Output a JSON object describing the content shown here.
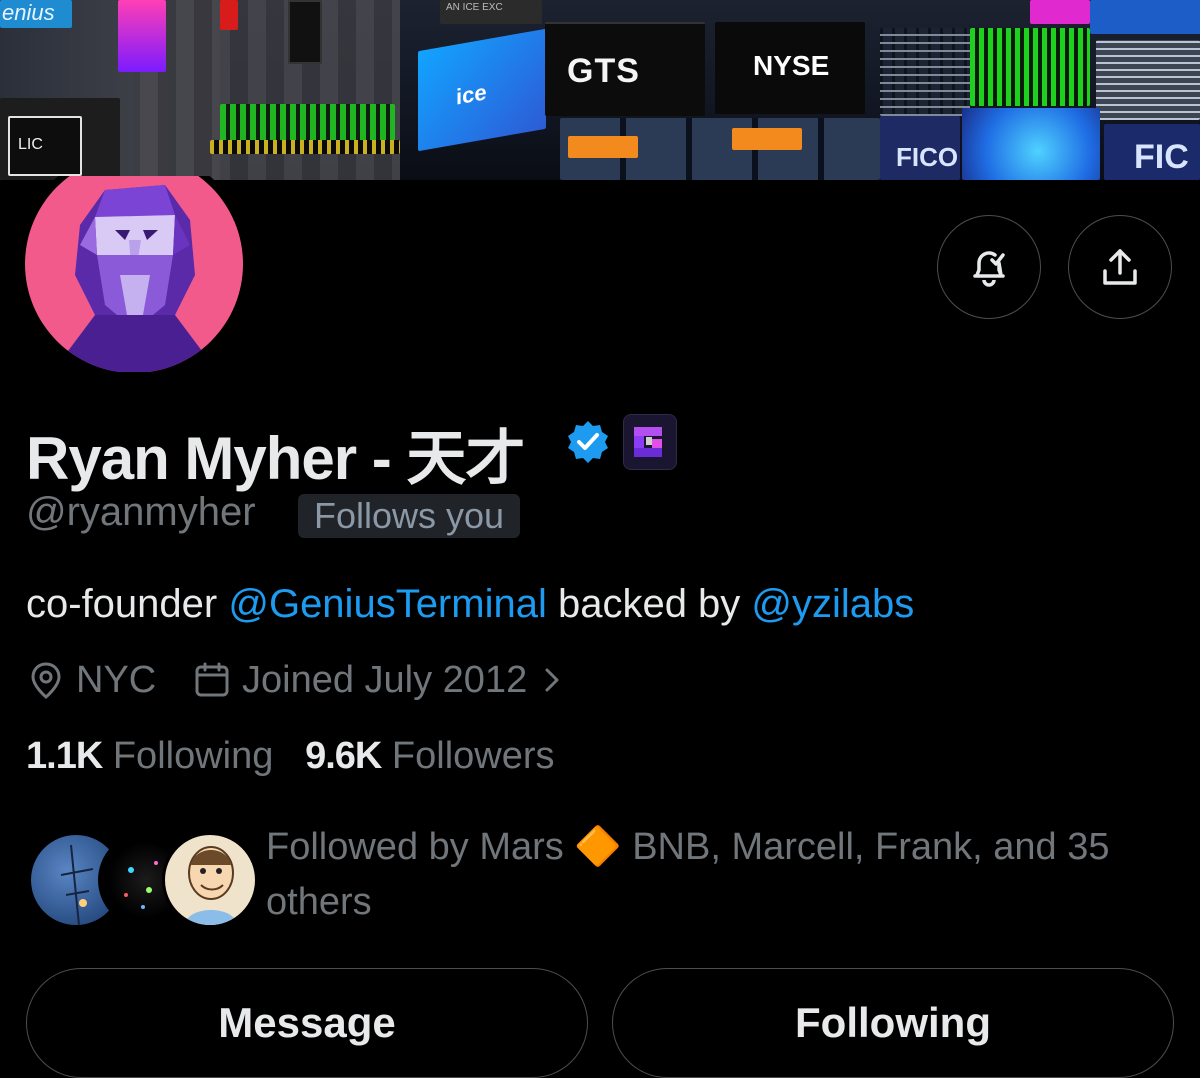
{
  "banner": {
    "signs": {
      "enius": "enius",
      "ice": "ice",
      "gts": "GTS",
      "nyse": "NYSE",
      "fico": "FICO",
      "fic": "FIC",
      "lice": "LIC",
      "top_sign": "AN ICE EXC"
    }
  },
  "profile": {
    "display_name": "Ryan Myher - 天才",
    "handle": "@ryanmyher",
    "follows_you_label": "Follows you",
    "bio": {
      "prefix": "co-founder ",
      "mention1": "@GeniusTerminal",
      "middle": " backed by ",
      "mention2": "@yzilabs"
    },
    "location": "NYC",
    "joined": "Joined July 2012",
    "following_count": "1.1K",
    "following_label": "Following",
    "followers_count": "9.6K",
    "followers_label": "Followers",
    "followed_by_text": "Followed by Mars 🔶 BNB, Marcell, Frank, and 35 others"
  },
  "actions": {
    "message_label": "Message",
    "following_label": "Following"
  },
  "colors": {
    "background": "#000000",
    "primary_text": "#e7e9ea",
    "secondary_text": "#71767b",
    "link": "#1d9bf0",
    "verified": "#1d9bf0"
  },
  "icons": {
    "notifications": "bell-check-icon",
    "share": "share-icon",
    "location": "location-pin-icon",
    "calendar": "calendar-icon",
    "chevron": "chevron-right-icon",
    "verified": "verified-badge-icon",
    "affiliate": "affiliate-badge-icon"
  }
}
